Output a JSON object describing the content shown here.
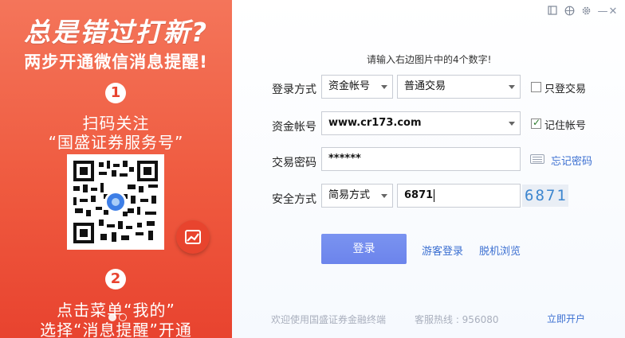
{
  "promo": {
    "headline": "总是错过打新?",
    "subheadline": "两步开通微信消息提醒!",
    "step1_number": "1",
    "step1_line1": "扫码关注",
    "step1_line2": "“国盛证券服务号”",
    "step2_number": "2",
    "step2_line1": "点击菜单“我的”",
    "step2_line2": "选择“消息提醒”开通",
    "carousel_dots": 2,
    "carousel_active": 0
  },
  "window_controls": {
    "restore_icon": "restore-icon",
    "skin_icon": "skin-icon",
    "settings_icon": "gear-icon",
    "minimize_label": "—",
    "close_label": "✕"
  },
  "form": {
    "hint": "请输入右边图片中的4个数字!",
    "login_mode_label": "登录方式",
    "login_mode_value": "资金帐号",
    "trade_type_value": "普通交易",
    "readonly_trade_label": "只登交易",
    "readonly_trade_checked": false,
    "account_label": "资金帐号",
    "account_value": "www.cr173.com",
    "remember_label": "记住帐号",
    "remember_checked": true,
    "password_label": "交易密码",
    "password_value": "******",
    "forgot_password": "忘记密码",
    "security_label": "安全方式",
    "security_mode_value": "简易方式",
    "captcha_input_value": "6871",
    "captcha_image_text": "6871",
    "login_button": "登录",
    "guest_login": "游客登录",
    "offline_browse": "脱机浏览"
  },
  "footer": {
    "welcome": "欢迎使用国盛证券金融终端",
    "hotline": "客服热线 : 956080",
    "open_account": "立即开户"
  },
  "colors": {
    "promo_bg": "#ef5a3f",
    "login_button": "#6c84ec",
    "link": "#3b6fd1"
  }
}
